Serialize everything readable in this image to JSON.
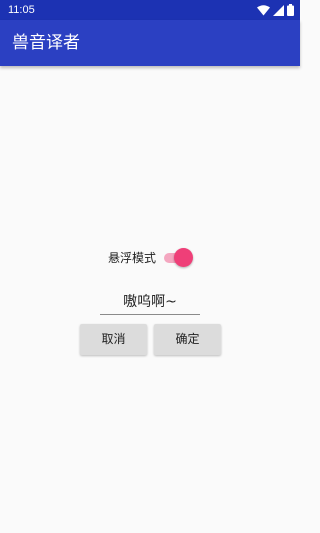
{
  "status_bar": {
    "time": "11:05",
    "icons": [
      "wifi-icon",
      "cell-signal-icon",
      "battery-icon"
    ]
  },
  "app_bar": {
    "title": "兽音译者"
  },
  "floating_mode": {
    "label": "悬浮模式",
    "enabled": true
  },
  "input": {
    "value": "嗷呜啊~"
  },
  "buttons": {
    "cancel": "取消",
    "confirm": "确定"
  },
  "colors": {
    "status_bar": "#1c32b3",
    "app_bar": "#2b40c2",
    "accent": "#ef3f78",
    "background": "#fafafa"
  }
}
